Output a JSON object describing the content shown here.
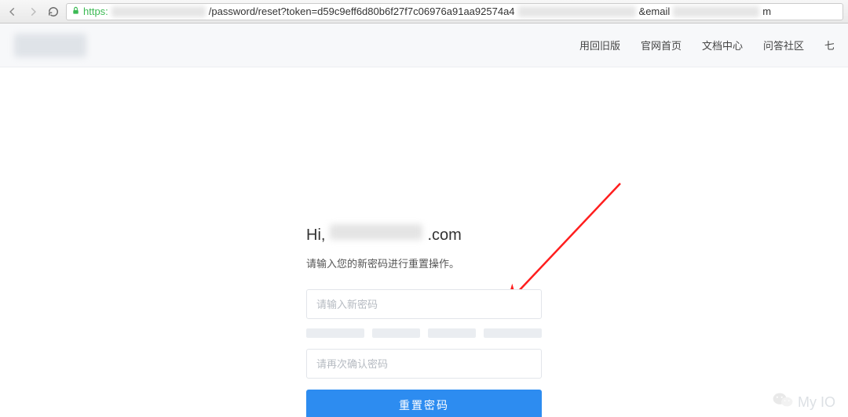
{
  "browser": {
    "url_https": "https:",
    "url_path": "/password/reset?token=d59c9eff6d80b6f27f7c06976a91aa92574a4",
    "url_email_param": "&email",
    "url_tail": "m"
  },
  "header": {
    "nav": {
      "old_version": "用回旧版",
      "home": "官网首页",
      "docs": "文档中心",
      "community": "问答社区",
      "cutoff": "七"
    }
  },
  "form": {
    "greeting_prefix": "Hi,",
    "greeting_suffix": ".com",
    "subtitle": "请输入您的新密码进行重置操作。",
    "password_placeholder": "请输入新密码",
    "confirm_placeholder": "请再次确认密码",
    "submit_label": "重置密码"
  },
  "watermark": {
    "text": "My IO"
  }
}
